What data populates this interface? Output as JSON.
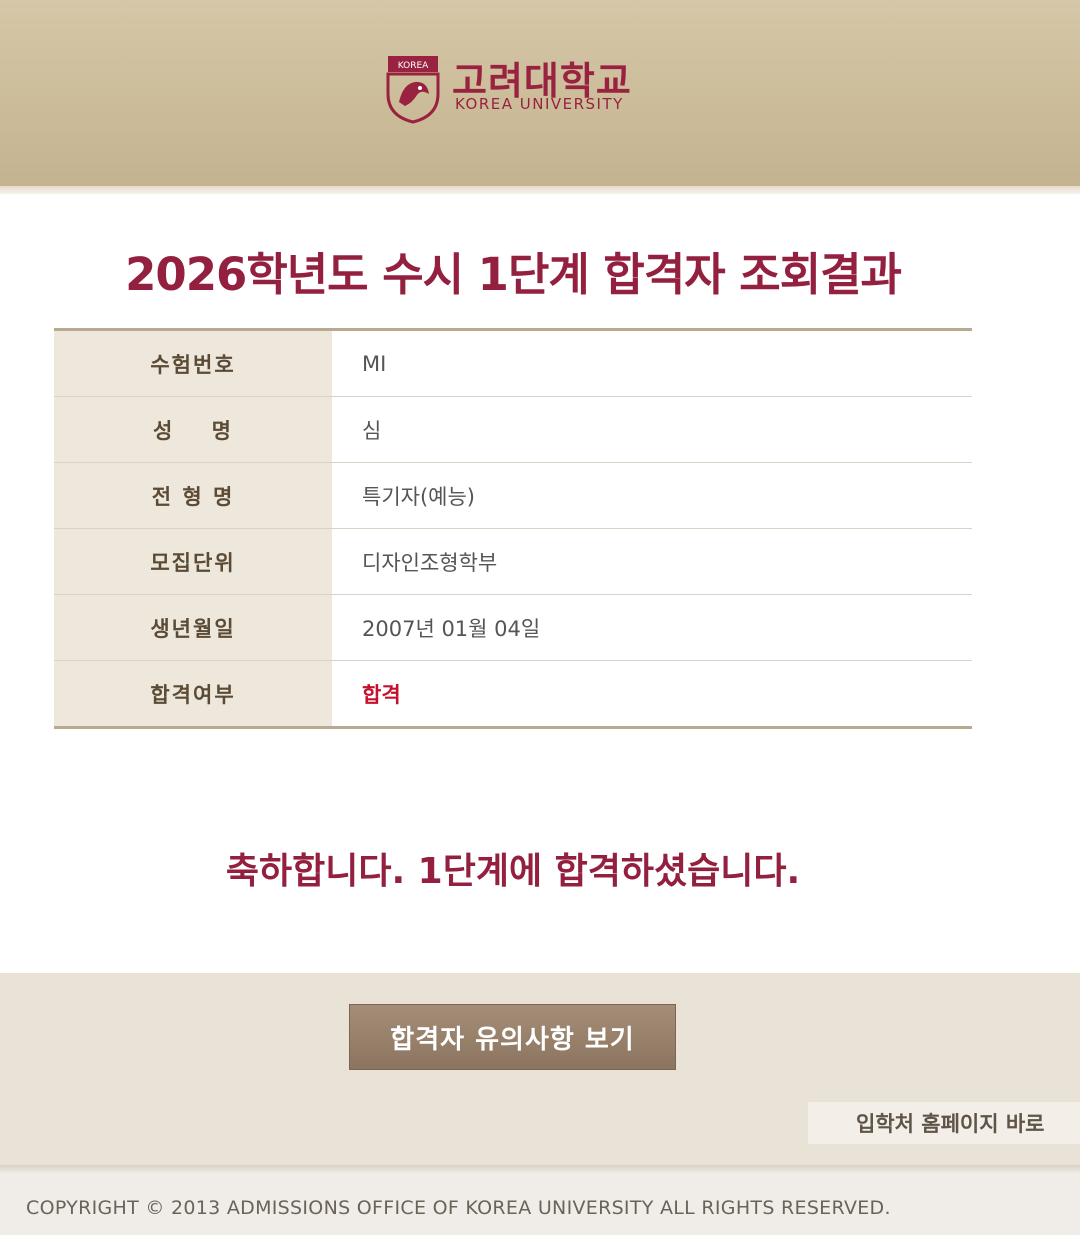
{
  "header": {
    "logo_kr": "고려대학교",
    "logo_en": "KOREA UNIVERSITY",
    "seal_text": "KOREA",
    "seal_icon": "tiger-shield-icon",
    "brand_color": "#98223f"
  },
  "title": "2026학년도 수시 1단계 합격자 조회결과",
  "info": {
    "rows": [
      {
        "label": "수험번호",
        "value": "MI"
      },
      {
        "label": "성    명",
        "value": "심"
      },
      {
        "label": "전 형 명",
        "value": "특기자(예능)"
      },
      {
        "label": "모집단위",
        "value": "디자인조형학부"
      },
      {
        "label": "생년월일",
        "value": "2007년 01월 04일"
      },
      {
        "label": "합격여부",
        "value": "합격"
      }
    ]
  },
  "congrats": "축하합니다. 1단계에 합격하셨습니다.",
  "buttons": {
    "notice": "합격자 유의사항 보기",
    "home": "입학처 홈페이지 바로"
  },
  "footer": {
    "copyright": "COPYRIGHT © 2013 ADMISSIONS OFFICE OF KOREA UNIVERSITY ALL RIGHTS RESERVED."
  },
  "colors": {
    "pass": "#c4102c",
    "title": "#93203e",
    "header_bg": "#cbbb99"
  }
}
